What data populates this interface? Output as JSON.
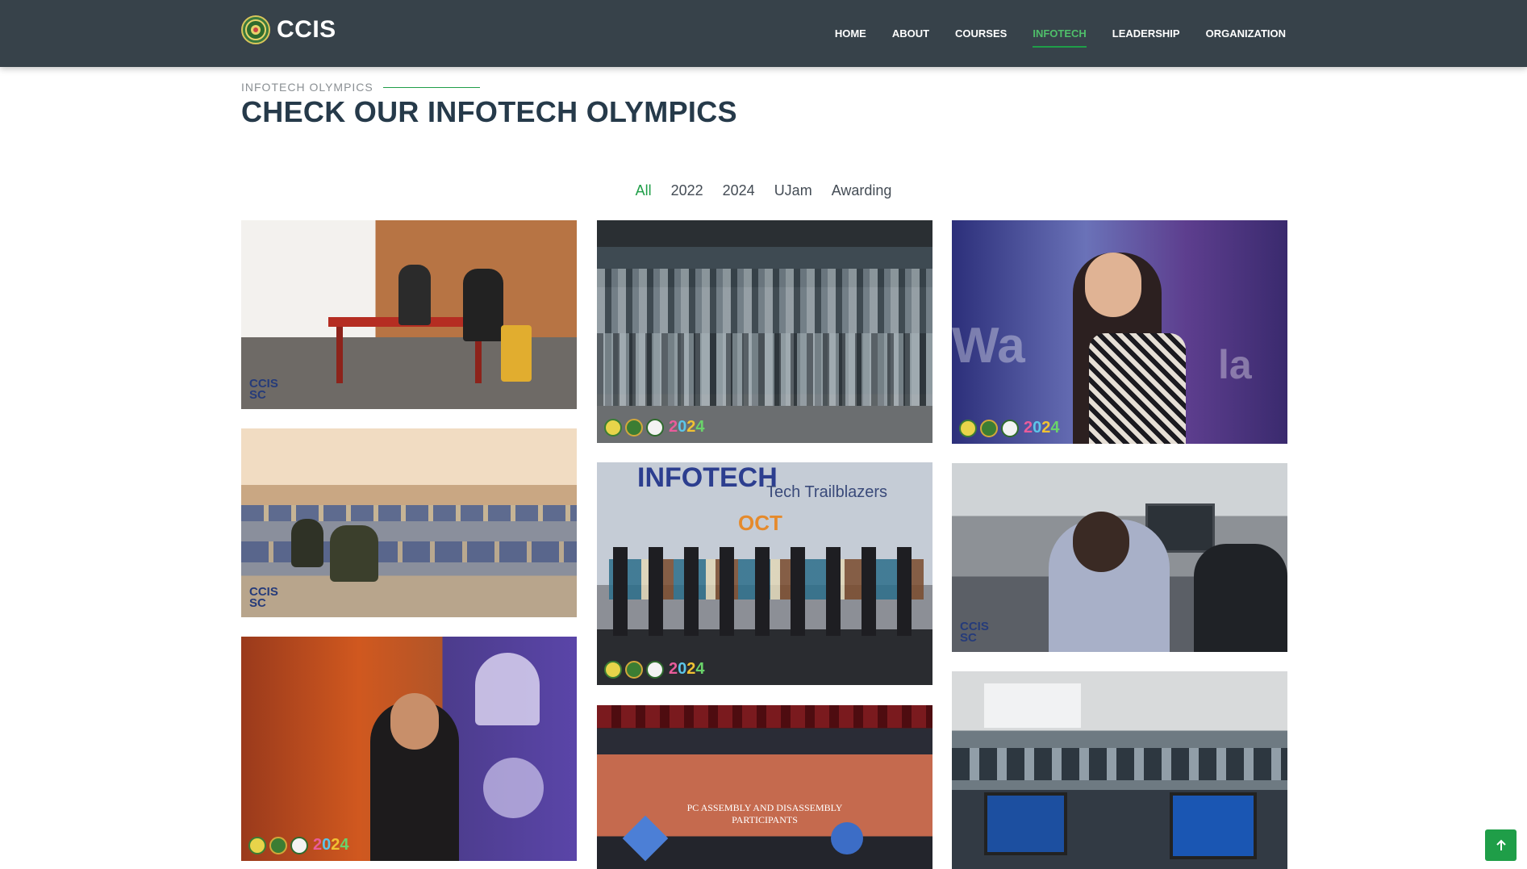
{
  "header": {
    "brand_name": "CCIS",
    "nav": [
      {
        "label": "HOME"
      },
      {
        "label": "ABOUT"
      },
      {
        "label": "COURSES"
      },
      {
        "label": "INFOTECH",
        "active": true
      },
      {
        "label": "LEADERSHIP"
      },
      {
        "label": "ORGANIZATION"
      }
    ]
  },
  "section": {
    "eyebrow": "INFOTECH OLYMPICS",
    "title": "CHECK OUR INFOTECH OLYMPICS"
  },
  "filters": [
    "All",
    "2022",
    "2024",
    "UJam",
    "Awarding"
  ],
  "gallery": {
    "watermark": [
      "CCIS",
      "SC"
    ],
    "year_badge": [
      "2",
      "0",
      "2",
      "4"
    ],
    "banner_texts": {
      "tech_trailblazers": "Tech Trailblazers",
      "infotech": "INFOTECH",
      "oct": "OCT",
      "pc_assembly": "PC ASSEMBLY AND DISASSEMBLY",
      "participants": "PARTICIPANTS"
    }
  },
  "colors": {
    "header_bg": "#37424a",
    "accent": "#1f9e48",
    "heading": "#263a4a"
  },
  "icons": {
    "scroll_top": "arrow-up-icon",
    "brand": "ccis-logo-icon"
  }
}
